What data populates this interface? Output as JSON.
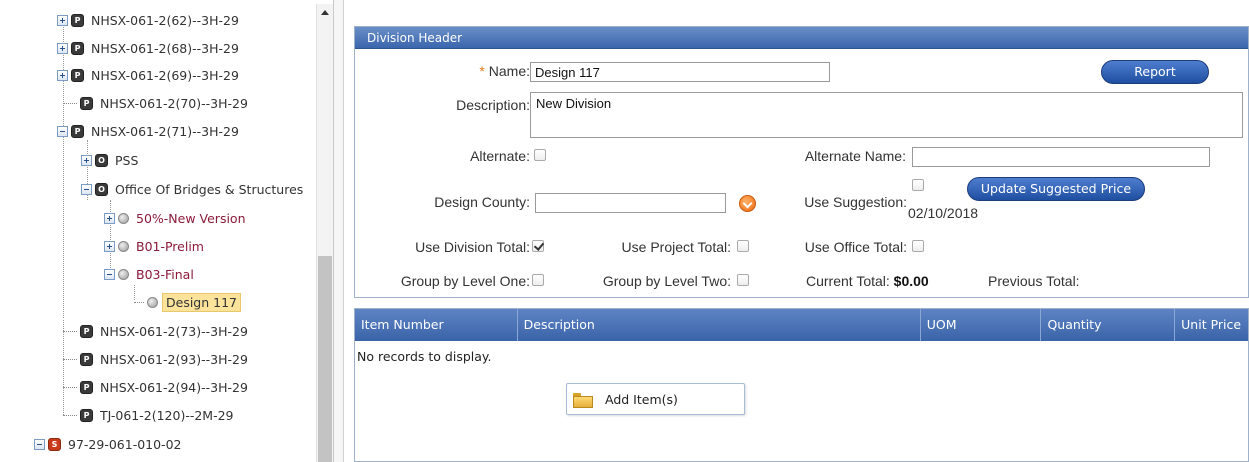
{
  "tree": {
    "nodes": [
      {
        "label": "NHSX-061-2(62)--3H-29",
        "icon": "project-icon",
        "icon_text": "P",
        "expander": "plus"
      },
      {
        "label": "NHSX-061-2(68)--3H-29",
        "icon": "project-icon",
        "icon_text": "P",
        "expander": "plus"
      },
      {
        "label": "NHSX-061-2(69)--3H-29",
        "icon": "project-icon",
        "icon_text": "P",
        "expander": "plus"
      },
      {
        "label": "NHSX-061-2(70)--3H-29",
        "icon": "project-icon",
        "icon_text": "P",
        "expander": "none"
      },
      {
        "label": "NHSX-061-2(71)--3H-29",
        "icon": "project-icon",
        "icon_text": "P",
        "expander": "minus"
      },
      {
        "label": "PSS",
        "icon": "office-icon",
        "icon_text": "O",
        "expander": "plus"
      },
      {
        "label": "Office Of Bridges & Structures",
        "icon": "office-icon",
        "icon_text": "O",
        "expander": "minus"
      },
      {
        "label": "50%-New Version",
        "icon": "estimate-dot-icon",
        "expander": "plus",
        "style": "red"
      },
      {
        "label": "B01-Prelim",
        "icon": "estimate-dot-icon",
        "expander": "plus",
        "style": "red"
      },
      {
        "label": "B03-Final",
        "icon": "estimate-dot-icon",
        "expander": "minus",
        "style": "red"
      },
      {
        "label": "Design 117",
        "icon": "division-dot-icon",
        "expander": "none",
        "style": "selected"
      },
      {
        "label": "NHSX-061-2(73)--3H-29",
        "icon": "project-icon",
        "icon_text": "P",
        "expander": "none"
      },
      {
        "label": "NHSX-061-2(93)--3H-29",
        "icon": "project-icon",
        "icon_text": "P",
        "expander": "none"
      },
      {
        "label": "NHSX-061-2(94)--3H-29",
        "icon": "project-icon",
        "icon_text": "P",
        "expander": "none"
      },
      {
        "label": "TJ-061-2(120)--2M-29",
        "icon": "project-icon",
        "icon_text": "P",
        "expander": "none"
      },
      {
        "label": "97-29-061-010-02",
        "icon": "state-project-icon",
        "icon_text": "S",
        "expander": "minus"
      }
    ]
  },
  "division": {
    "title": "Division Header",
    "required_mark": "*",
    "name_label": "Name:",
    "name_value": "Design 117",
    "report_button": "Report",
    "description_label": "Description:",
    "description_value": "New Division",
    "alternate_label": "Alternate:",
    "alternate_checked": false,
    "alternate_name_label": "Alternate Name:",
    "alternate_name_value": "",
    "design_county_label": "Design County:",
    "design_county_value": "",
    "use_suggestion_label": "Use Suggestion:",
    "use_suggestion_checked": false,
    "suggestion_date": "02/10/2018",
    "update_price_button": "Update Suggested Price",
    "use_division_total_label": "Use Division Total:",
    "use_division_total_checked": true,
    "use_project_total_label": "Use Project Total:",
    "use_project_total_checked": false,
    "use_office_total_label": "Use Office Total:",
    "use_office_total_checked": false,
    "group_level_one_label": "Group by Level One:",
    "group_level_one_checked": false,
    "group_level_two_label": "Group by Level Two:",
    "group_level_two_checked": false,
    "current_total_label": "Current Total:",
    "current_total_value": "$0.00",
    "previous_total_label": "Previous Total:"
  },
  "grid": {
    "columns": [
      "Item Number",
      "Description",
      "UOM",
      "Quantity",
      "Unit Price"
    ],
    "empty_text": "No records to display."
  },
  "context_menu": {
    "items": [
      {
        "label": "Add Item(s)",
        "icon": "folder-icon"
      }
    ]
  },
  "colors": {
    "header_blue": "#3b66ad",
    "selected_bg": "#fbe39b",
    "red_text": "#8b1a3b",
    "orange_accent": "#ee6a10"
  }
}
